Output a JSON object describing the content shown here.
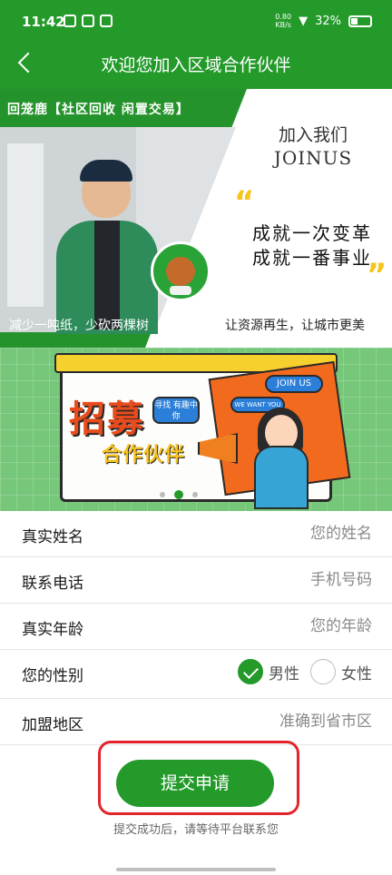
{
  "status": {
    "time": "11:42",
    "speed_top": "0.80",
    "speed_bottom": "KB/s",
    "battery": "32%"
  },
  "nav": {
    "title": "欢迎您加入区域合作伙伴"
  },
  "hero": {
    "brand": "回笼鹿【社区回收 闲置交易】",
    "join_cn": "加入我们",
    "join_en": "JOINUS",
    "quote_open": "“",
    "quote_close": "”",
    "line1": "成就一次变革",
    "line2": "成就一番事业",
    "left_slogan": "减少一吨纸，少砍两棵树",
    "right_slogan": "让资源再生，让城市更美"
  },
  "recruit": {
    "big": "招募",
    "sub": "合作伙伴",
    "tag": "寻找 有趣中你",
    "join_us": "JOIN US",
    "we_want": "WE WANT YOU"
  },
  "form": {
    "name": {
      "label": "真实姓名",
      "placeholder": "您的姓名"
    },
    "phone": {
      "label": "联系电话",
      "placeholder": "手机号码"
    },
    "age": {
      "label": "真实年龄",
      "placeholder": "您的年龄"
    },
    "gender": {
      "label": "您的性别",
      "male": "男性",
      "female": "女性",
      "selected": "male"
    },
    "region": {
      "label": "加盟地区",
      "placeholder": "准确到省市区"
    }
  },
  "submit": {
    "label": "提交申请",
    "hint": "提交成功后，请等待平台联系您"
  }
}
